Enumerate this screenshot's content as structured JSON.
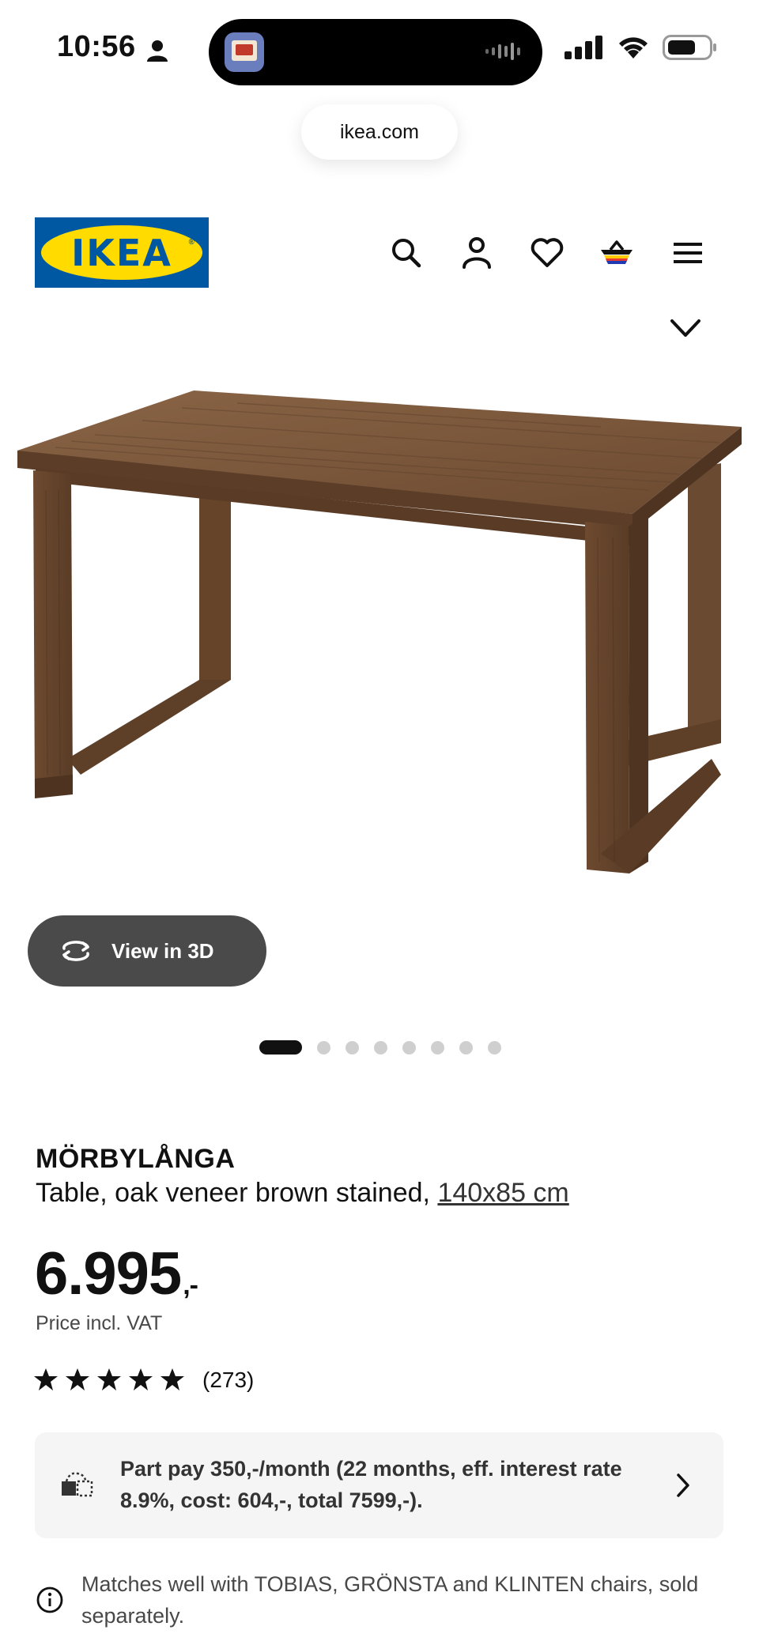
{
  "status_bar": {
    "time": "10:56",
    "icons": [
      "person-icon",
      "audio-wave-icon",
      "signal-icon",
      "wifi-icon",
      "battery-icon"
    ]
  },
  "browser": {
    "url": "ikea.com"
  },
  "header": {
    "logo_text": "IKEA",
    "logo_colors": {
      "blue": "#0058a3",
      "yellow": "#ffdb00"
    },
    "icons": [
      "search-icon",
      "account-icon",
      "wishlist-heart-icon",
      "cart-basket-icon",
      "menu-icon"
    ]
  },
  "gallery": {
    "view_3d_label": "View in 3D",
    "dot_count": 8,
    "active_dot": 1
  },
  "product": {
    "name": "MÖRBYLÅNGA",
    "description": "Table, oak veneer brown stained, ",
    "size_link": "140x85 cm",
    "price": "6.995",
    "price_suffix": ",-",
    "vat_note": "Price incl. VAT",
    "rating": 5,
    "review_count": "(273)"
  },
  "part_pay": {
    "text": "Part pay 350,-/month (22 months, eff. interest rate 8.9%, cost: 604,-, total 7599,-)."
  },
  "matches": {
    "text": "Matches well with TOBIAS, GRÖNSTA and KLINTEN chairs, sold separately."
  }
}
